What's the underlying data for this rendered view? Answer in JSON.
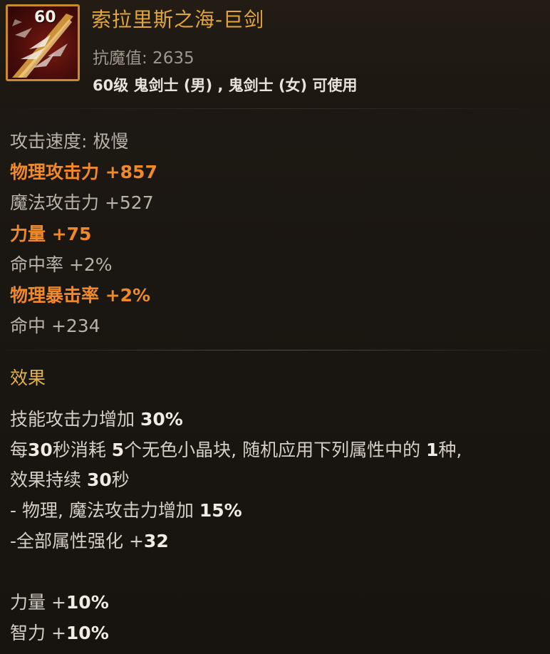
{
  "item": {
    "level": "60",
    "name": "索拉里斯之海-巨剑",
    "anti_magic": "抗魔值: 2635",
    "usable_by": "60级 鬼剑士 (男) , 鬼剑士 (女) 可使用"
  },
  "stats": [
    {
      "text": "攻击速度: 极慢",
      "style": "gray"
    },
    {
      "text": "物理攻击力 +857",
      "style": "orange"
    },
    {
      "text": "魔法攻击力 +527",
      "style": "gray"
    },
    {
      "text": "力量 +75",
      "style": "orange"
    },
    {
      "text": "命中率 +2%",
      "style": "gray"
    },
    {
      "text": "物理暴击率 +2%",
      "style": "orange"
    },
    {
      "text": "命中 +234",
      "style": "gray"
    }
  ],
  "effects": {
    "title": "效果",
    "lines": [
      {
        "label": "技能攻击力增加 ",
        "value": "30%"
      },
      {
        "parts": [
          "每",
          "30",
          "秒消耗 ",
          "5",
          "个无色小晶块, 随机应用下列属性中的 ",
          "1",
          "种,"
        ]
      },
      {
        "parts": [
          "效果持续 ",
          "30",
          "秒"
        ]
      },
      {
        "label": " - 物理, 魔法攻击力增加 ",
        "value": "15%"
      },
      {
        "label": " -全部属性强化 +",
        "value": "32"
      }
    ],
    "bonus": [
      {
        "label": "力量 +",
        "value": "10%"
      },
      {
        "label": "智力 +",
        "value": "10%"
      }
    ]
  },
  "colors": {
    "name": "#e0a53c",
    "highlight": "#f0892a",
    "frame": "#c88a2e"
  },
  "icons": [
    "greatsword-icon"
  ]
}
